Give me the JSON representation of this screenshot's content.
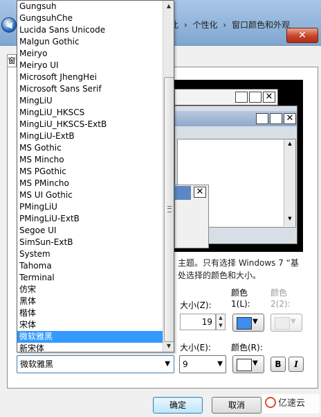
{
  "window": {
    "breadcrumb": [
      "此",
      "›",
      "个性化",
      "›",
      "窗口颜色和外观"
    ],
    "close_label": "✕"
  },
  "tab": {
    "label": "窗"
  },
  "font_dropdown": {
    "items": [
      "Gungsuh",
      "GungsuhChe",
      "Lucida Sans Unicode",
      "Malgun Gothic",
      "Meiryo",
      "Meiryo UI",
      "Microsoft JhengHei",
      "Microsoft Sans Serif",
      "MingLiU",
      "MingLiU_HKSCS",
      "MingLiU_HKSCS-ExtB",
      "MingLiU-ExtB",
      "MS Gothic",
      "MS Mincho",
      "MS PGothic",
      "MS PMincho",
      "MS UI Gothic",
      "PMingLiU",
      "PMingLiU-ExtB",
      "Segoe UI",
      "SimSun-ExtB",
      "System",
      "Tahoma",
      "Terminal",
      "仿宋",
      "黑体",
      "楷体",
      "宋体",
      "微软雅黑",
      "新宋体"
    ],
    "selected": "微软雅黑",
    "combo_value": "微软雅黑"
  },
  "description": {
    "line1": "主题。只有选择 Windows 7 “基",
    "line2": "处选择的颜色和大小。"
  },
  "item_row": {
    "size_label": "大小(Z):",
    "size_value": "19",
    "color1_label": "颜色",
    "color1_sub": "1(L):",
    "color1_value": "#3d8ef0",
    "color2_label": "颜色",
    "color2_sub": "2(2):"
  },
  "font_row": {
    "size_label": "大小(E):",
    "size_value": "9",
    "color_label": "颜色(R):",
    "color_value": "#ffffff",
    "bold_label": "B",
    "italic_label": "I"
  },
  "buttons": {
    "ok": "确定",
    "cancel": "取消"
  },
  "watermark": {
    "text": "亿速云"
  }
}
